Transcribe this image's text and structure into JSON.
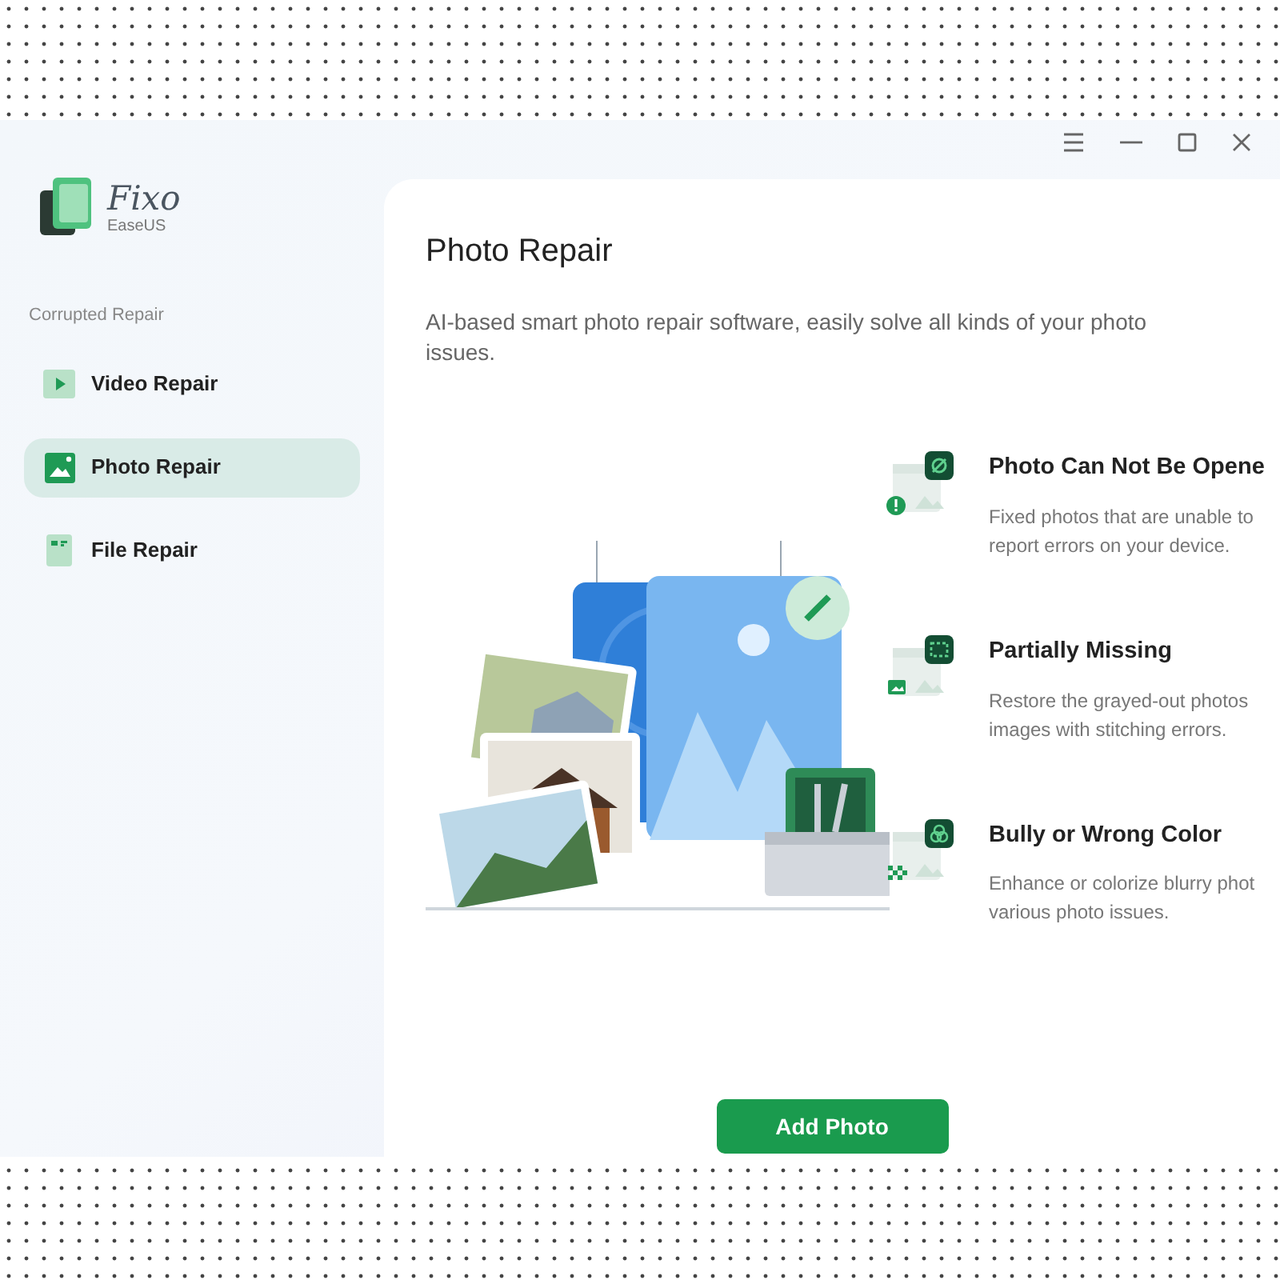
{
  "logo": {
    "name": "Fixo",
    "brand": "EaseUS"
  },
  "sidebar": {
    "section": "Corrupted Repair",
    "items": [
      {
        "label": "Video Repair",
        "kind": "video",
        "selected": false
      },
      {
        "label": "Photo Repair",
        "kind": "photo",
        "selected": true
      },
      {
        "label": "File Repair",
        "kind": "file",
        "selected": false
      }
    ]
  },
  "main": {
    "title": "Photo Repair",
    "description": "AI-based smart photo repair software, easily solve all kinds of your photo issues.",
    "features": [
      {
        "kind": "unopenable",
        "title": "Photo Can Not Be Opene",
        "lines": [
          "Fixed photos that are unable to",
          "report errors on your device."
        ]
      },
      {
        "kind": "missing",
        "title": "Partially Missing",
        "lines": [
          "Restore the grayed-out photos",
          "images with stitching errors."
        ]
      },
      {
        "kind": "color",
        "title": "Bully or Wrong Color",
        "lines": [
          "Enhance or colorize blurry phot",
          "various photo issues."
        ]
      }
    ],
    "button": "Add Photo"
  }
}
